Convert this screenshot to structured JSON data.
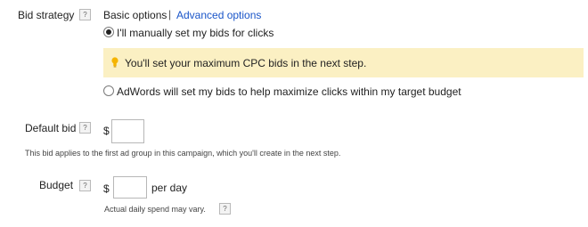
{
  "bid_strategy": {
    "label": "Bid strategy",
    "help": "?",
    "options_tabs": {
      "basic": "Basic options",
      "separator": "|",
      "advanced": "Advanced options"
    },
    "manual_option": {
      "label": "I'll manually set my bids for clicks",
      "selected": true
    },
    "info_banner": "You'll set your maximum CPC bids in the next step.",
    "auto_option": {
      "label": "AdWords will set my bids to help maximize clicks within my target budget",
      "selected": false
    }
  },
  "default_bid": {
    "label": "Default bid",
    "help": "?",
    "currency": "$",
    "value": "",
    "note": "This bid applies to the first ad group in this campaign, which you'll create in the next step."
  },
  "budget": {
    "label": "Budget",
    "help": "?",
    "currency": "$",
    "value": "",
    "unit": "per day",
    "note": "Actual daily spend may vary.",
    "note_help": "?"
  },
  "colors": {
    "link": "#1a55c8",
    "banner_bg": "#fbf0c3",
    "bulb": "#f5b400"
  }
}
